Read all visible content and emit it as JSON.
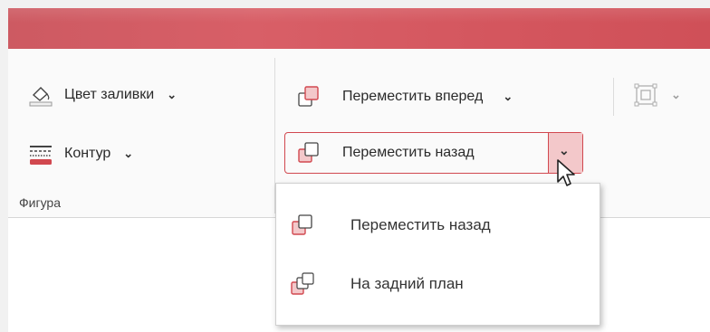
{
  "ribbon": {
    "fill_color_label": "Цвет заливки",
    "outline_label": "Контур",
    "group_shape_label": "Фигура",
    "bring_forward_label": "Переместить вперед",
    "send_backward_label": "Переместить назад"
  },
  "menu": {
    "items": [
      {
        "label": "Переместить назад",
        "icon": "send-backward-icon"
      },
      {
        "label": "На задний план",
        "icon": "send-to-back-icon"
      }
    ]
  },
  "colors": {
    "accent": "#d1484f",
    "titlebar": "#d65c64",
    "icon_fill": "#f3c8ca"
  }
}
